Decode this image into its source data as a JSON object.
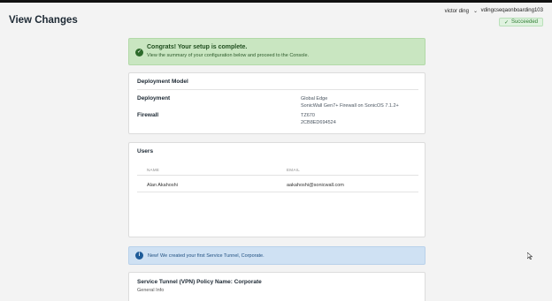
{
  "header": {
    "title": "View Changes",
    "user_name": "victor ding",
    "tenant": "vdingcseqaonboarding103",
    "status": "Succeeded"
  },
  "success_alert": {
    "headline": "Congrats! Your setup is complete.",
    "message": "View the summary of your configuration below and proceed to the Console."
  },
  "deployment": {
    "title": "Deployment Model",
    "rows": [
      {
        "label": "Deployment",
        "values": [
          "Global Edge",
          "SonicWall Gen7+ Firewall on SonicOS 7.1.2+"
        ]
      },
      {
        "label": "Firewall",
        "values": [
          "TZ670",
          "2CB8ED694524"
        ]
      }
    ]
  },
  "users": {
    "title": "Users",
    "columns": [
      "NAME",
      "EMAIL"
    ],
    "rows": [
      {
        "name": "Alan Akahoshi",
        "email": "aakahoshi@sonicwall.com"
      }
    ]
  },
  "info_alert": {
    "message": "New! We created your first Service Tunnel, Corporate."
  },
  "tunnel": {
    "title": "Service Tunnel (VPN) Policy Name: Corporate",
    "subtitle": "General Info"
  },
  "colors": {
    "success_bg": "#c9e6c1",
    "info_bg": "#cfe1f3",
    "badge_green": "#2e7d32"
  },
  "icons": [
    "check-circle-icon",
    "chevron-down-icon",
    "check-icon",
    "info-circle-icon",
    "mouse-cursor-icon"
  ]
}
